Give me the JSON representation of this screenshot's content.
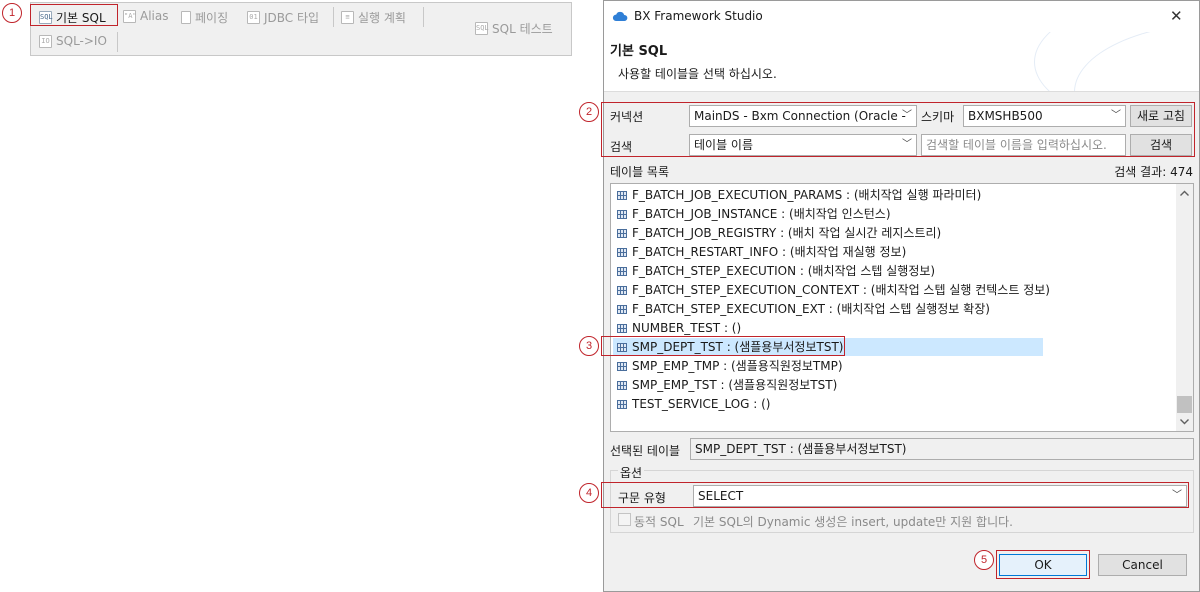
{
  "colors": {
    "accent_red": "#c0242b",
    "selection": "#cce8ff",
    "dialog_bg": "#f0f0f0"
  },
  "toolbar": {
    "items": [
      {
        "label": "기본 SQL",
        "icon": "sql-icon",
        "enabled": true
      },
      {
        "label": "Alias",
        "icon": "alias-icon",
        "enabled": false
      },
      {
        "label": "페이징",
        "icon": "paging-icon",
        "enabled": false
      },
      {
        "label": "JDBC 타입",
        "icon": "jdbc-icon",
        "enabled": false
      },
      {
        "label": "실행 계획",
        "icon": "execution-plan-icon",
        "enabled": false
      },
      {
        "label": "SQL 테스트",
        "icon": "sql-test-icon",
        "enabled": false
      },
      {
        "label": "SQL->IO",
        "icon": "sql-to-io-icon",
        "enabled": false
      }
    ]
  },
  "markers": [
    "1",
    "2",
    "3",
    "4",
    "5"
  ],
  "dialog": {
    "window_title": "BX Framework Studio",
    "close_glyph": "✕",
    "header_title": "기본 SQL",
    "header_desc": "사용할 테이블을 선택 하십시오.",
    "connection": {
      "label": "커넥션",
      "value": "MainDS - Bxm Connection (Oracle -",
      "schema_label": "스키마",
      "schema_value": "BXMSHB500",
      "refresh_label": "새로 고침"
    },
    "search": {
      "label": "검색",
      "type_value": "테이블 이름",
      "placeholder": "검색할 테이블 이름을 입력하십시오.",
      "button_label": "검색"
    },
    "table_list": {
      "label": "테이블 목록",
      "result": "검색 결과: 474",
      "items": [
        "F_BATCH_JOB_EXECUTION_PARAMS : (배치작업 실행 파라미터)",
        "F_BATCH_JOB_INSTANCE : (배치작업 인스턴스)",
        "F_BATCH_JOB_REGISTRY : (배치 작업 실시간 레지스트리)",
        "F_BATCH_RESTART_INFO : (배치작업 재실행 정보)",
        "F_BATCH_STEP_EXECUTION : (배치작업 스텝 실행정보)",
        "F_BATCH_STEP_EXECUTION_CONTEXT : (배치작업 스텝 실행 컨텍스트 정보)",
        "F_BATCH_STEP_EXECUTION_EXT : (배치작업 스텝 실행정보 확장)",
        "NUMBER_TEST : ()",
        "SMP_DEPT_TST : (샘플용부서정보TST)",
        "SMP_EMP_TMP : (샘플용직원정보TMP)",
        "SMP_EMP_TST : (샘플용직원정보TST)",
        "TEST_SERVICE_LOG : ()"
      ],
      "selected_index": 8
    },
    "selected_table": {
      "label": "선택된 테이블",
      "value": "SMP_DEPT_TST : (샘플용부서정보TST)"
    },
    "options": {
      "group_label": "옵션",
      "statement_type_label": "구문 유형",
      "statement_type_value": "SELECT",
      "dynamic_sql_label": "동적 SQL",
      "dynamic_sql_desc": "기본 SQL의 Dynamic 생성은 insert, update만 지원 합니다."
    },
    "ok_label": "OK",
    "cancel_label": "Cancel"
  }
}
